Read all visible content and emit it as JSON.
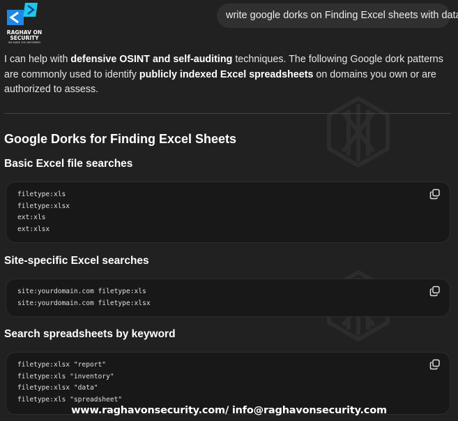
{
  "logo": {
    "line1": "RAGHAV ON",
    "line2": "SECURITY",
    "tagline": "WE MAKE YOU INFORMED"
  },
  "user_message": "write google dorks on Finding Excel sheets with data",
  "response": {
    "intro": {
      "p1": "I can help with ",
      "b1": "defensive OSINT and self-auditing",
      "p2": " techniques. The following Google dork patterns are commonly used to identify ",
      "b2": "publicly indexed Excel spreadsheets",
      "p3": " on domains you own or are authorized to assess."
    },
    "heading": "Google Dorks for Finding Excel Sheets",
    "sections": [
      {
        "title": "Basic Excel file searches",
        "lines": [
          "filetype:xls",
          "filetype:xlsx",
          "ext:xls",
          "ext:xlsx"
        ]
      },
      {
        "title": "Site-specific Excel searches",
        "lines": [
          "site:yourdomain.com filetype:xls",
          "site:yourdomain.com filetype:xlsx"
        ]
      },
      {
        "title": "Search spreadsheets by keyword",
        "lines": [
          "filetype:xlsx \"report\"",
          "filetype:xls \"inventory\"",
          "filetype:xlsx \"data\"",
          "filetype:xls \"spreadsheet\""
        ]
      }
    ]
  },
  "watermark": {
    "text": "AIPRM"
  },
  "footer": "www.raghavonsecurity.com/ info@raghavonsecurity.com",
  "icons": {
    "copy": "copy-icon",
    "watermark_logo": "aiprm-logo-icon"
  },
  "colors": {
    "background": "#212121",
    "bubble": "#303030",
    "code_bg": "#181818",
    "logo_accent": "#1e88e5"
  }
}
